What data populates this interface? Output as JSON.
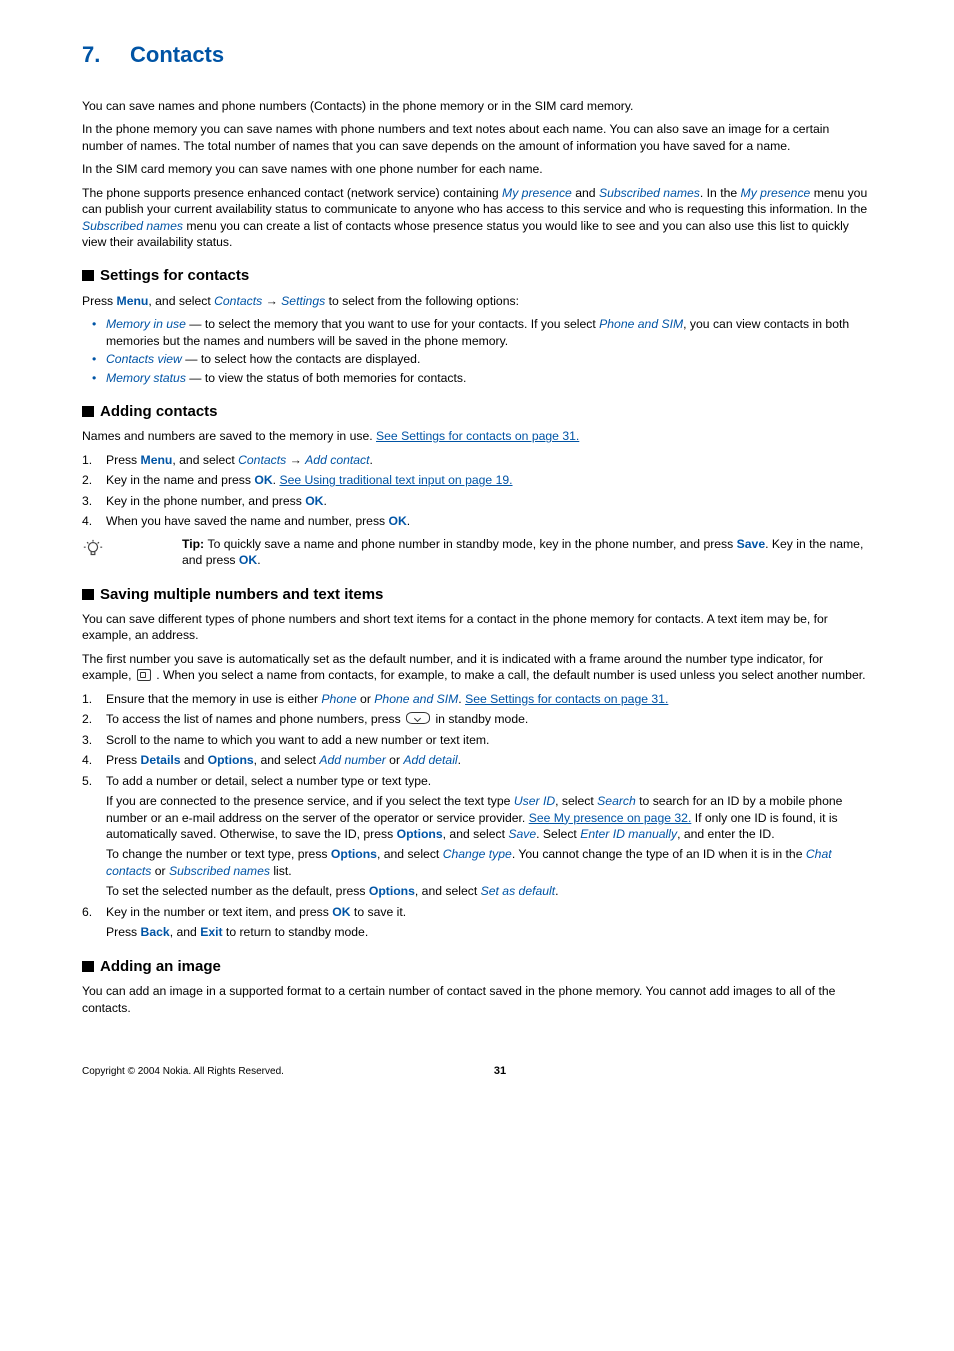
{
  "chapter": {
    "number": "7.",
    "title": "Contacts"
  },
  "intro": {
    "p1": "You can save names and phone numbers (Contacts) in the phone memory or in the SIM card memory.",
    "p2": "In the phone memory you can save names with phone numbers and text notes about each name. You can also save an image for a certain number of names. The total number of names that you can save depends on the amount of information you have saved for a name.",
    "p3": "In the SIM card memory you can save names with one phone number for each name.",
    "p4a": "The phone supports presence enhanced contact (network service) containing ",
    "p4_i1": "My presence",
    "p4b": " and ",
    "p4_i2": "Subscribed names",
    "p4c": ". In the ",
    "p4_i3": "My presence",
    "p4d": " menu you can publish your current availability status to communicate to anyone who has access to this service and who is requesting this information. In the ",
    "p4_i4": "Subscribed names",
    "p4e": " menu you can create a list of contacts whose presence status you would like to see and you can also use this list to quickly view their availability status."
  },
  "settings": {
    "heading": "Settings for contacts",
    "lead_a": "Press ",
    "lead_menu": "Menu",
    "lead_b": ", and select ",
    "lead_i1": "Contacts",
    "lead_c": " → ",
    "lead_i2": "Settings",
    "lead_d": " to select from the following options:",
    "b1_i": "Memory in use",
    "b1_a": " — to select the memory that you want to use for your contacts. If you select ",
    "b1_i2": "Phone and SIM",
    "b1_b": ", you can view contacts in both memories but the names and numbers will be saved in the phone memory.",
    "b2_i": "Contacts view",
    "b2_a": " — to select how the contacts are displayed.",
    "b3_i": "Memory status",
    "b3_a": " — to view the status of both memories for contacts."
  },
  "adding": {
    "heading": "Adding contacts",
    "lead_a": "Names and numbers are saved to the memory in use. ",
    "lead_link": "See Settings for contacts on page 31.",
    "s1_a": "Press ",
    "s1_menu": "Menu",
    "s1_b": ", and select ",
    "s1_i1": "Contacts",
    "s1_c": " → ",
    "s1_i2": "Add contact",
    "s1_d": ".",
    "s2_a": "Key in the name and press ",
    "s2_ok": "OK",
    "s2_b": ". ",
    "s2_link": "See Using traditional text input on page 19.",
    "s3_a": "Key in the phone number, and press ",
    "s3_ok": "OK",
    "s3_b": ".",
    "s4_a": "When you have saved the name and number, press ",
    "s4_ok": "OK",
    "s4_b": ".",
    "tip_label": "Tip: ",
    "tip_a": "To quickly save a name and phone number in standby mode, key in the phone number, and press ",
    "tip_save": "Save",
    "tip_b": ". Key in the name, and press ",
    "tip_ok": "OK",
    "tip_c": "."
  },
  "multi": {
    "heading": "Saving multiple numbers and text items",
    "p1": "You can save different types of phone numbers and short text items for a contact in the phone memory for contacts. A text item may be, for example, an address.",
    "p2a": "The first number you save is automatically set as the default number, and it is indicated with a frame around the number type indicator, for example, ",
    "p2b": " . When you select a name from contacts, for example, to make a call, the default number is used unless you select another number.",
    "s1_a": "Ensure that the memory in use is either ",
    "s1_i1": "Phone",
    "s1_b": " or ",
    "s1_i2": "Phone and SIM",
    "s1_c": ". ",
    "s1_link": "See Settings for contacts on page 31.",
    "s2_a": "To access the list of names and phone numbers, press ",
    "s2_b": " in standby mode.",
    "s3": "Scroll to the name to which you want to add a new number or text item.",
    "s4_a": "Press ",
    "s4_details": "Details",
    "s4_b": " and ",
    "s4_options": "Options",
    "s4_c": ", and select ",
    "s4_i1": "Add number",
    "s4_d": " or ",
    "s4_i2": "Add detail",
    "s4_e": ".",
    "s5a": "To add a number or detail, select a number type or text type.",
    "s5p1_a": "If you are connected to the presence service, and if you select the text type ",
    "s5p1_i1": "User ID",
    "s5p1_b": ", select ",
    "s5p1_i2": "Search",
    "s5p1_c": " to search for an ID by a mobile phone number or an e-mail address on the server of the operator or service provider. ",
    "s5p1_link": "See My presence on page 32.",
    "s5p1_d": " If only one ID is found, it is automatically saved. Otherwise, to save the ID, press ",
    "s5p1_options": "Options",
    "s5p1_e": ", and select ",
    "s5p1_i3": "Save",
    "s5p1_f": ". Select ",
    "s5p1_i4": "Enter ID manually",
    "s5p1_g": ", and enter the ID.",
    "s5p2_a": "To change the number or text type, press ",
    "s5p2_options": "Options",
    "s5p2_b": ", and select ",
    "s5p2_i1": "Change type",
    "s5p2_c": ". You cannot change the type of an ID when it is in the ",
    "s5p2_i2": "Chat contacts",
    "s5p2_d": " or ",
    "s5p2_i3": "Subscribed names",
    "s5p2_e": " list.",
    "s5p3_a": "To set the selected number as the default, press ",
    "s5p3_options": "Options",
    "s5p3_b": ", and select ",
    "s5p3_i1": "Set as default",
    "s5p3_c": ".",
    "s6_a": "Key in the number or text item, and press ",
    "s6_ok": "OK",
    "s6_b": " to save it.",
    "s6p1_a": "Press ",
    "s6p1_back": "Back",
    "s6p1_b": ", and ",
    "s6p1_exit": "Exit",
    "s6p1_c": " to return to standby mode."
  },
  "image": {
    "heading": "Adding an image",
    "p1": "You can add an image in a supported format to a certain number of contact saved in the phone memory. You cannot add images to all of the contacts."
  },
  "footer": {
    "copyright": "Copyright © 2004 Nokia. All Rights Reserved.",
    "page": "31"
  }
}
